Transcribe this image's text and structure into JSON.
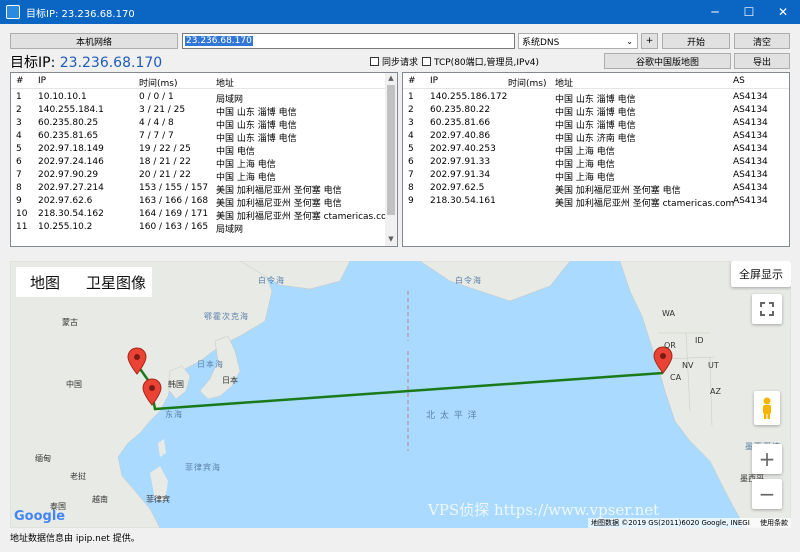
{
  "window": {
    "title": "目标IP: 23.236.68.170",
    "minimize": "─",
    "maximize": "☐",
    "close": "✕"
  },
  "toolbar": {
    "local_network": "本机网络",
    "ip_value": "23.236.68.170",
    "dns_select": "系统DNS",
    "plus": "+",
    "start": "开始",
    "clear": "清空",
    "google_map": "谷歌中国版地图",
    "export": "导出"
  },
  "target": {
    "label": "目标IP: ",
    "ip": "23.236.68.170"
  },
  "options": {
    "sync_request": "同步请求",
    "tcp": "TCP(80端口,管理员,IPv4)"
  },
  "left_table": {
    "headers": [
      "#",
      "IP",
      "时间(ms)",
      "地址"
    ],
    "rows": [
      [
        "1",
        "10.10.10.1",
        "0 / 0 / 1",
        "局域网"
      ],
      [
        "2",
        "140.255.184.1",
        "3 / 21 / 25",
        "中国 山东 淄博 电信"
      ],
      [
        "3",
        "60.235.80.25",
        "4 / 4 / 8",
        "中国 山东 淄博 电信"
      ],
      [
        "4",
        "60.235.81.65",
        "7 / 7 / 7",
        "中国 山东 淄博 电信"
      ],
      [
        "5",
        "202.97.18.149",
        "19 / 22 / 25",
        "中国 电信"
      ],
      [
        "6",
        "202.97.24.146",
        "18 / 21 / 22",
        "中国 上海 电信"
      ],
      [
        "7",
        "202.97.90.29",
        "20 / 21 / 22",
        "中国 上海 电信"
      ],
      [
        "8",
        "202.97.27.214",
        "153 / 155 / 157",
        "美国 加利福尼亚州 圣何塞 电信"
      ],
      [
        "9",
        "202.97.62.6",
        "163 / 166 / 168",
        "美国 加利福尼亚州 圣何塞 电信"
      ],
      [
        "10",
        "218.30.54.162",
        "164 / 169 / 171",
        "美国 加利福尼亚州 圣何塞 ctamericas.com"
      ],
      [
        "11",
        "10.255.10.2",
        "160 / 163 / 165",
        "局域网"
      ]
    ]
  },
  "right_table": {
    "headers": [
      "#",
      "IP",
      "时间(ms)",
      "地址",
      "AS"
    ],
    "rows": [
      [
        "1",
        "140.255.186.172",
        "",
        "中国 山东 淄博 电信",
        "AS4134"
      ],
      [
        "2",
        "60.235.80.22",
        "",
        "中国 山东 淄博 电信",
        "AS4134"
      ],
      [
        "3",
        "60.235.81.66",
        "",
        "中国 山东 淄博 电信",
        "AS4134"
      ],
      [
        "4",
        "202.97.40.86",
        "",
        "中国 山东 济南 电信",
        "AS4134"
      ],
      [
        "5",
        "202.97.40.253",
        "",
        "中国 上海 电信",
        "AS4134"
      ],
      [
        "6",
        "202.97.91.33",
        "",
        "中国 上海 电信",
        "AS4134"
      ],
      [
        "7",
        "202.97.91.34",
        "",
        "中国 上海 电信",
        "AS4134"
      ],
      [
        "8",
        "202.97.62.5",
        "",
        "美国 加利福尼亚州 圣何塞 电信",
        "AS4134"
      ],
      [
        "9",
        "218.30.54.161",
        "",
        "美国 加利福尼亚州 圣何塞 ctamericas.com",
        "AS4134"
      ]
    ]
  },
  "map": {
    "tab_map": "地图",
    "tab_satellite": "卫星图像",
    "fullscreen": "全屏显示",
    "labels": {
      "mongolia": "蒙古",
      "china": "中国",
      "korea": "韩国",
      "japan_sea": "日本海",
      "japan": "日本",
      "east_sea": "东海",
      "philippine_sea": "菲律宾海",
      "myanmar": "缅甸",
      "laos": "老挝",
      "vietnam": "越南",
      "thailand": "泰国",
      "philippines": "菲律宾",
      "bering_sea": "白令海",
      "bering": "白令海",
      "okhotsk_sea": "鄂霍次克海",
      "pacific": "北 太 平 洋",
      "mexico": "墨西哥",
      "gulf": "墨西哥湾",
      "ca": "CA",
      "wa": "WA",
      "or": "OR",
      "id": "ID",
      "nv": "NV",
      "az": "AZ",
      "ut": "UT"
    },
    "watermark": "VPS侦探 https://www.vpser.net",
    "attribution": "地图数据 ©2019 GS(2011)6020 Google, INEGI",
    "terms": "使用条款",
    "google": "Google",
    "zoom_in": "+",
    "zoom_out": "−"
  },
  "footer": "地址数据信息由 ipip.net 提供。",
  "colors": {
    "titlebar": "#0a66c2",
    "route": "#1a7a1a",
    "pin": "#ea4335",
    "sea": "#aadaff",
    "land": "#e8eae6"
  }
}
